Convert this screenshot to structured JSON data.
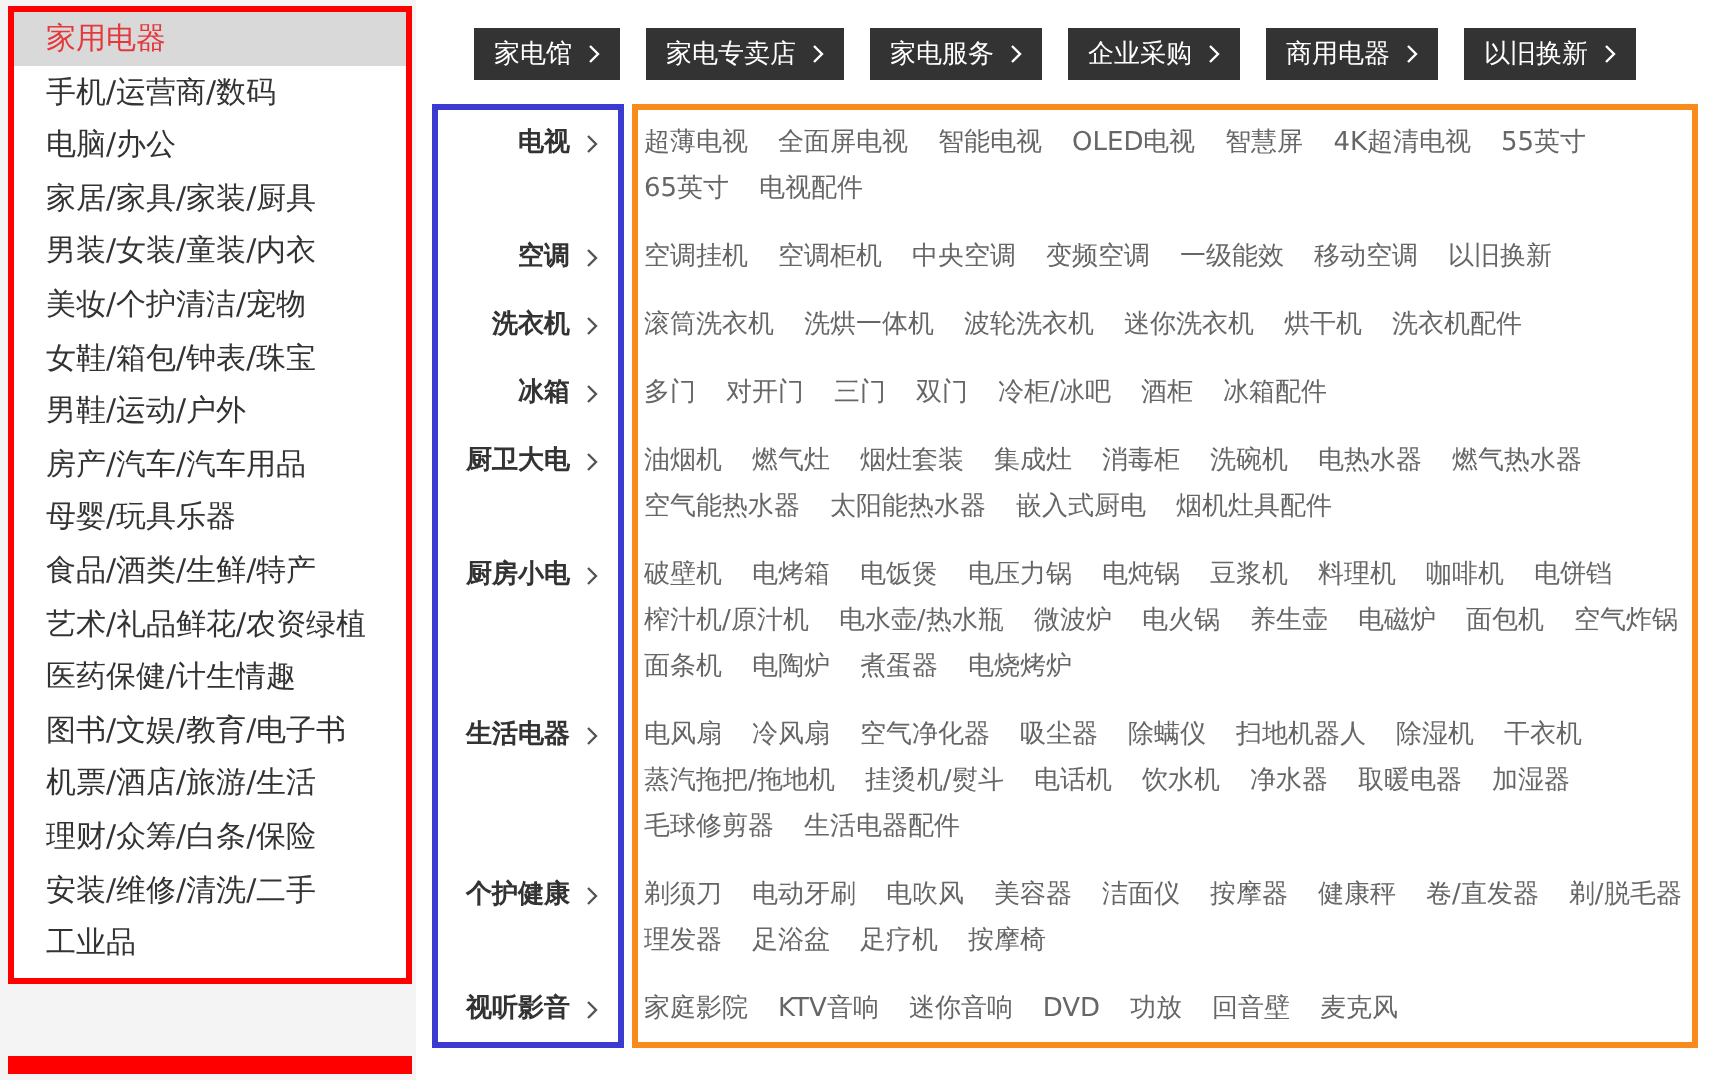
{
  "sidebar": {
    "items": [
      {
        "label": "家用电器",
        "selected": true
      },
      {
        "label": "手机/运营商/数码",
        "selected": false
      },
      {
        "label": "电脑/办公",
        "selected": false
      },
      {
        "label": "家居/家具/家装/厨具",
        "selected": false
      },
      {
        "label": "男装/女装/童装/内衣",
        "selected": false
      },
      {
        "label": "美妆/个护清洁/宠物",
        "selected": false
      },
      {
        "label": "女鞋/箱包/钟表/珠宝",
        "selected": false
      },
      {
        "label": "男鞋/运动/户外",
        "selected": false
      },
      {
        "label": "房产/汽车/汽车用品",
        "selected": false
      },
      {
        "label": "母婴/玩具乐器",
        "selected": false
      },
      {
        "label": "食品/酒类/生鲜/特产",
        "selected": false
      },
      {
        "label": "艺术/礼品鲜花/农资绿植",
        "selected": false
      },
      {
        "label": "医药保健/计生情趣",
        "selected": false
      },
      {
        "label": "图书/文娱/教育/电子书",
        "selected": false
      },
      {
        "label": "机票/酒店/旅游/生活",
        "selected": false
      },
      {
        "label": "理财/众筹/白条/保险",
        "selected": false
      },
      {
        "label": "安装/维修/清洗/二手",
        "selected": false
      },
      {
        "label": "工业品",
        "selected": false
      }
    ]
  },
  "channels": [
    "家电馆",
    "家电专卖店",
    "家电服务",
    "企业采购",
    "商用电器",
    "以旧换新"
  ],
  "categories": [
    {
      "name": "电视",
      "items": [
        "超薄电视",
        "全面屏电视",
        "智能电视",
        "OLED电视",
        "智慧屏",
        "4K超清电视",
        "55英寸",
        "65英寸",
        "电视配件"
      ]
    },
    {
      "name": "空调",
      "items": [
        "空调挂机",
        "空调柜机",
        "中央空调",
        "变频空调",
        "一级能效",
        "移动空调",
        "以旧换新"
      ]
    },
    {
      "name": "洗衣机",
      "items": [
        "滚筒洗衣机",
        "洗烘一体机",
        "波轮洗衣机",
        "迷你洗衣机",
        "烘干机",
        "洗衣机配件"
      ]
    },
    {
      "name": "冰箱",
      "items": [
        "多门",
        "对开门",
        "三门",
        "双门",
        "冷柜/冰吧",
        "酒柜",
        "冰箱配件"
      ]
    },
    {
      "name": "厨卫大电",
      "items": [
        "油烟机",
        "燃气灶",
        "烟灶套装",
        "集成灶",
        "消毒柜",
        "洗碗机",
        "电热水器",
        "燃气热水器",
        "空气能热水器",
        "太阳能热水器",
        "嵌入式厨电",
        "烟机灶具配件"
      ]
    },
    {
      "name": "厨房小电",
      "items": [
        "破壁机",
        "电烤箱",
        "电饭煲",
        "电压力锅",
        "电炖锅",
        "豆浆机",
        "料理机",
        "咖啡机",
        "电饼铛",
        "榨汁机/原汁机",
        "电水壶/热水瓶",
        "微波炉",
        "电火锅",
        "养生壶",
        "电磁炉",
        "面包机",
        "空气炸锅",
        "面条机",
        "电陶炉",
        "煮蛋器",
        "电烧烤炉"
      ]
    },
    {
      "name": "生活电器",
      "items": [
        "电风扇",
        "冷风扇",
        "空气净化器",
        "吸尘器",
        "除螨仪",
        "扫地机器人",
        "除湿机",
        "干衣机",
        "蒸汽拖把/拖地机",
        "挂烫机/熨斗",
        "电话机",
        "饮水机",
        "净水器",
        "取暖电器",
        "加湿器",
        "毛球修剪器",
        "生活电器配件"
      ]
    },
    {
      "name": "个护健康",
      "items": [
        "剃须刀",
        "电动牙刷",
        "电吹风",
        "美容器",
        "洁面仪",
        "按摩器",
        "健康秤",
        "卷/直发器",
        "剃/脱毛器",
        "理发器",
        "足浴盆",
        "足疗机",
        "按摩椅"
      ]
    },
    {
      "name": "视听影音",
      "items": [
        "家庭影院",
        "KTV音响",
        "迷你音响",
        "DVD",
        "功放",
        "回音壁",
        "麦克风"
      ]
    }
  ]
}
